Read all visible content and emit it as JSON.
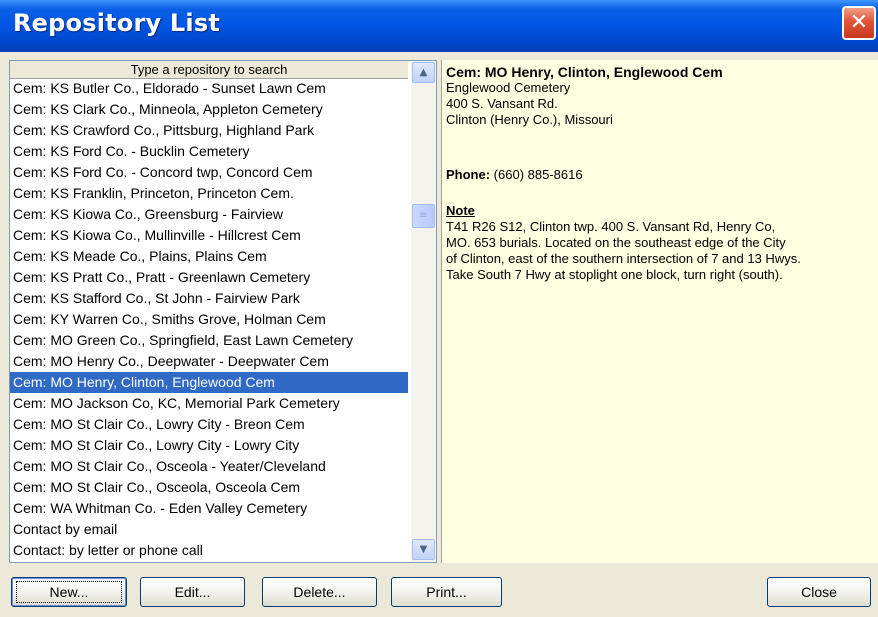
{
  "window": {
    "title": "Repository List",
    "close_glyph": "✕"
  },
  "list": {
    "header": "Type a repository to search",
    "selected_index": 14,
    "items": [
      "Cem:  KS Butler Co., Eldorado - Sunset Lawn Cem",
      "Cem:  KS Clark Co., Minneola, Appleton Cemetery",
      "Cem:  KS Crawford Co., Pittsburg, Highland Park",
      "Cem:  KS Ford Co. - Bucklin Cemetery",
      "Cem:  KS Ford Co. - Concord twp, Concord Cem",
      "Cem:  KS Franklin, Princeton, Princeton Cem.",
      "Cem:  KS Kiowa Co., Greensburg - Fairview",
      "Cem:  KS Kiowa Co., Mullinville - Hillcrest Cem",
      "Cem:  KS Meade Co., Plains, Plains Cem",
      "Cem:  KS Pratt Co., Pratt - Greenlawn Cemetery",
      "Cem:  KS Stafford Co., St John - Fairview Park",
      "Cem:  KY Warren Co., Smiths Grove, Holman Cem",
      "Cem:  MO Green Co., Springfield, East Lawn Cemetery",
      "Cem:  MO Henry Co., Deepwater - Deepwater Cem",
      "Cem:  MO Henry, Clinton, Englewood Cem",
      "Cem:  MO Jackson Co, KC, Memorial Park Cemetery",
      "Cem:  MO St Clair Co., Lowry City - Breon Cem",
      "Cem:  MO St Clair Co., Lowry City - Lowry City",
      "Cem:  MO St Clair Co., Osceola - Yeater/Cleveland",
      "Cem:  MO St Clair Co., Osceola, Osceola Cem",
      "Cem:  WA Whitman Co. - Eden Valley Cemetery",
      "Contact by email",
      "Contact: by letter or phone call"
    ]
  },
  "scrollbar": {
    "up_glyph": "▲",
    "down_glyph": "▼",
    "thumb_glyph": "≡"
  },
  "details": {
    "title": "Cem:  MO Henry, Clinton, Englewood Cem",
    "address": [
      "Englewood Cemetery",
      "400 S. Vansant Rd.",
      "Clinton (Henry Co.), Missouri"
    ],
    "phone_label": "Phone:",
    "phone_value": " (660) 885-8616",
    "note_label": "Note",
    "note_lines": [
      "T41 R26 S12, Clinton twp.  400 S. Vansant Rd, Henry Co,",
      "MO.  653 burials.  Located on the southeast edge of the City",
      "of Clinton, east of the southern intersection of 7 and 13 Hwys.",
      "Take South 7 Hwy at stoplight one block, turn right (south)."
    ]
  },
  "buttons": {
    "new": "New...",
    "edit": "Edit...",
    "delete": "Delete...",
    "print": "Print...",
    "close": "Close"
  }
}
